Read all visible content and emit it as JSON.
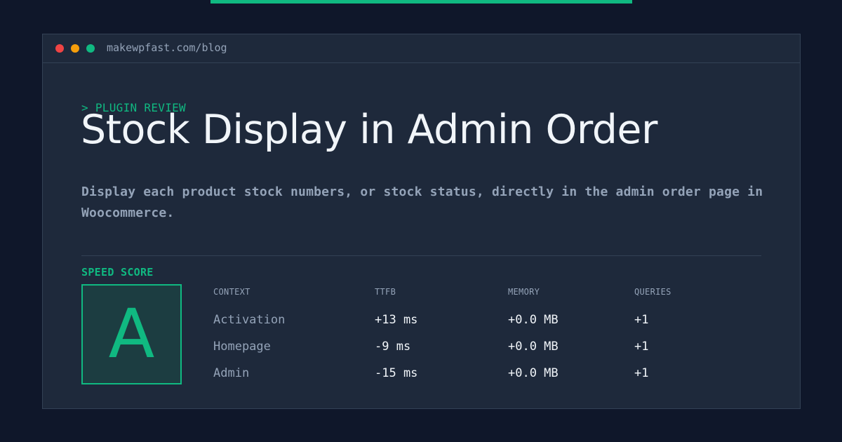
{
  "colors": {
    "background": "#0f172a",
    "panel": "#1e293b",
    "accent": "#10b981",
    "dot_red": "#ef4444",
    "dot_yellow": "#f59e0b",
    "dot_green": "#10b981"
  },
  "window": {
    "controls": [
      "close-dot",
      "minimize-dot",
      "maximize-dot"
    ],
    "url": "makewpfast.com/blog"
  },
  "article": {
    "tag": "> PLUGIN REVIEW",
    "title": "Stock Display in Admin Order",
    "description": "Display each product stock numbers, or stock status, directly in the admin order page in Woocommerce."
  },
  "speed": {
    "label": "SPEED SCORE",
    "grade": "A"
  },
  "table": {
    "headers": {
      "context": "CONTEXT",
      "ttfb": "TTFB",
      "memory": "MEMORY",
      "queries": "QUERIES"
    },
    "rows": [
      {
        "context": "Activation",
        "ttfb": "+13 ms",
        "memory": "+0.0 MB",
        "queries": "+1"
      },
      {
        "context": "Homepage",
        "ttfb": "-9 ms",
        "memory": "+0.0 MB",
        "queries": "+1"
      },
      {
        "context": "Admin",
        "ttfb": "-15 ms",
        "memory": "+0.0 MB",
        "queries": "+1"
      }
    ]
  }
}
